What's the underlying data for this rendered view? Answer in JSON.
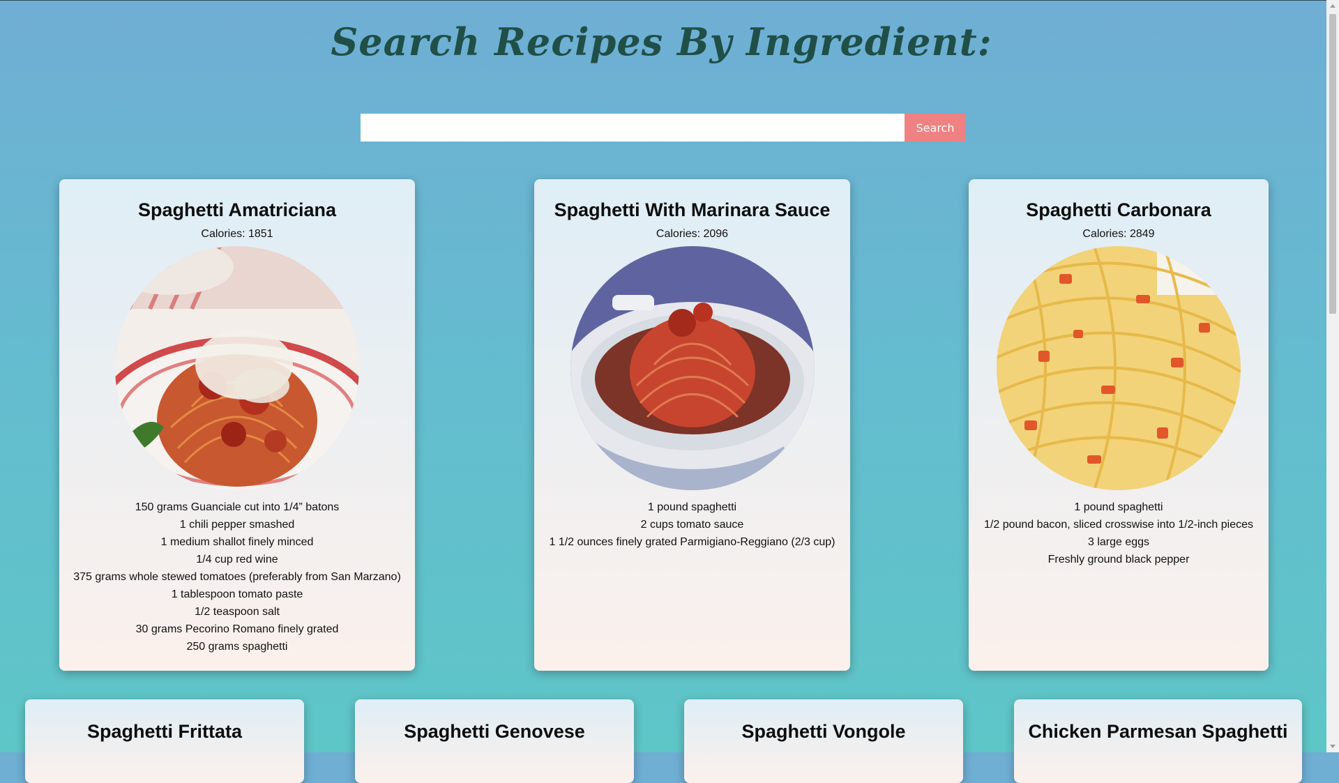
{
  "page": {
    "title": "Search Recipes By Ingredient:"
  },
  "search": {
    "placeholder": "",
    "value": "",
    "button_label": "Search",
    "button_color": "#ee8182"
  },
  "recipes": [
    {
      "name": "Spaghetti Amatriciana",
      "calories": "Calories: 1851",
      "ingredients": [
        "150 grams Guanciale cut into 1/4” batons",
        "1 chili pepper smashed",
        "1 medium shallot finely minced",
        "1/4 cup red wine",
        "375 grams whole stewed tomatoes (preferably from San Marzano)",
        "1 tablespoon tomato paste",
        "1/2 teaspoon salt",
        "30 grams Pecorino Romano finely grated",
        "250 grams spaghetti"
      ]
    },
    {
      "name": "Spaghetti With Marinara Sauce",
      "calories": "Calories: 2096",
      "ingredients": [
        "1 pound spaghetti",
        "2 cups tomato sauce",
        "1 1/2 ounces finely grated Parmigiano-Reggiano (2/3 cup)"
      ]
    },
    {
      "name": "Spaghetti Carbonara",
      "calories": "Calories: 2849",
      "ingredients": [
        "1 pound spaghetti",
        "1/2 pound bacon, sliced crosswise into 1/2-inch pieces",
        "3 large eggs",
        "Freshly ground black pepper"
      ]
    },
    {
      "name": "Spaghetti Frittata"
    },
    {
      "name": "Spaghetti Genovese"
    },
    {
      "name": "Spaghetti Vongole"
    },
    {
      "name": "Chicken Parmesan Spaghetti"
    }
  ],
  "colors": {
    "title": "#1f4f47",
    "background_top": "#70aed4",
    "background_bottom": "#5ec6c7"
  }
}
